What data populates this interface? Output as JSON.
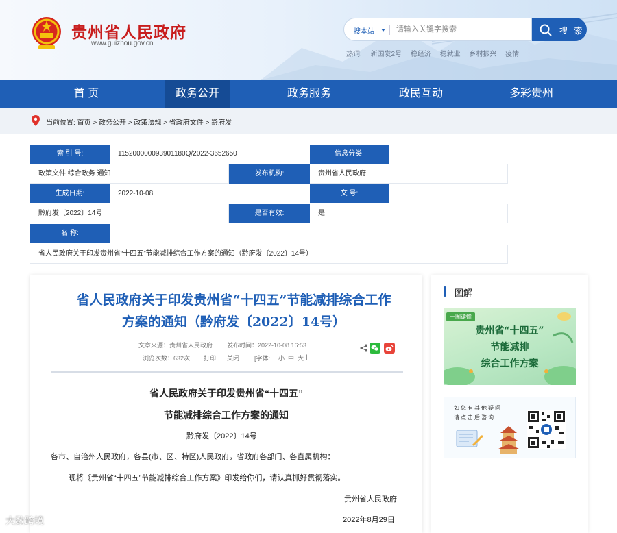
{
  "header": {
    "site_title": "贵州省人民政府",
    "site_url": "www.guizhou.gov.cn",
    "search_scope": "搜本站",
    "search_placeholder": "请输入关键字搜索",
    "search_button": "搜 索",
    "hot_label": "热词:",
    "hot_words": [
      "新国发2号",
      "稳经济",
      "稳就业",
      "乡村振兴",
      "疫情"
    ]
  },
  "nav": {
    "items": [
      "首 页",
      "政务公开",
      "政务服务",
      "政民互动",
      "多彩贵州"
    ],
    "active_index": 1
  },
  "breadcrumb": {
    "prefix": "当前位置:",
    "path": [
      "首页",
      "政务公开",
      "政策法规",
      "省政府文件",
      "黔府发"
    ],
    "separator": " > "
  },
  "info_table": {
    "index_no_label": "索 引 号:",
    "index_no": "115200000093901180Q/2022-3652650",
    "category_label": "信息分类:",
    "category": "政策文件   综合政务   通知",
    "publisher_label": "发布机构:",
    "publisher": "贵州省人民政府",
    "date_label": "生成日期:",
    "date": "2022-10-08",
    "doc_no_label": "文    号:",
    "doc_no": "黔府发〔2022〕14号",
    "valid_label": "是否有效:",
    "valid": "是",
    "name_label": "名    称:",
    "name": "省人民政府关于印发贵州省“十四五”节能减排综合工作方案的通知（黔府发〔2022〕14号）"
  },
  "article": {
    "title_line1": "省人民政府关于印发贵州省“十四五”节能减排综合工作",
    "title_line2": "方案的通知（黔府发〔2022〕14号）",
    "source": "文章来源：贵州省人民政府",
    "publish_time": "发布时间：2022-10-08 16:53",
    "views": "浏览次数：632次",
    "print": "打印",
    "close": "关闭",
    "font_label": "[字体:",
    "font_small": "小",
    "font_medium": "中",
    "font_large": "大",
    "font_end": "]",
    "doc_heading1": "省人民政府关于印发贵州省“十四五”",
    "doc_heading2": "节能减排综合工作方案的通知",
    "doc_number": "黔府发〔2022〕14号",
    "recipients": "各市、自治州人民政府，各县(市、区、特区)人民政府，省政府各部门、各直属机构：",
    "body": "现将《贵州省“十四五”节能减排综合工作方案》印发给你们，请认真抓好贯彻落实。",
    "signature": "贵州省人民政府",
    "sign_date": "2022年8月29日"
  },
  "side": {
    "title": "图解",
    "promo_tag": "一图读懂",
    "promo_line1": "贵州省“十四五”",
    "promo_line2": "节能减排",
    "promo_line3": "综合工作方案",
    "qa_line1": "如您有其他疑问",
    "qa_line2": "请点击后咨询"
  },
  "watermark": "大数跨境",
  "colors": {
    "brand_blue": "#1f5fb6",
    "brand_red": "#c81e1e",
    "nav_active": "#154b95"
  }
}
